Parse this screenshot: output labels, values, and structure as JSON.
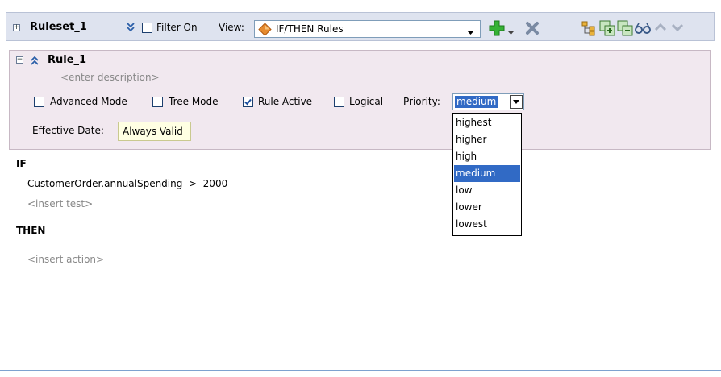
{
  "ruleset": {
    "name": "Ruleset_1",
    "filter_label": "Filter On",
    "view_label": "View:",
    "view_value": "IF/THEN Rules"
  },
  "rule": {
    "name": "Rule_1",
    "description_placeholder": "<enter description>",
    "advanced_mode_label": "Advanced Mode",
    "tree_mode_label": "Tree Mode",
    "rule_active_label": "Rule Active",
    "logical_label": "Logical",
    "priority_label": "Priority:",
    "priority_value": "medium",
    "priority_options": [
      "highest",
      "higher",
      "high",
      "medium",
      "low",
      "lower",
      "lowest"
    ],
    "effective_date_label": "Effective Date:",
    "effective_date_value": "Always Valid",
    "rule_active_checked": true
  },
  "body": {
    "if_label": "IF",
    "condition": "CustomerOrder.annualSpending  >  2000",
    "insert_test": "<insert test>",
    "then_label": "THEN",
    "insert_action": "<insert action>"
  },
  "colors": {
    "ruleset_bg": "#dee3ef",
    "rule_panel_bg": "#f1e8ef",
    "selection": "#316ac5",
    "add_icon": "#2aa52a",
    "delete_icon": "#7a8aa3",
    "eff_date_bg": "#ffffe3"
  }
}
